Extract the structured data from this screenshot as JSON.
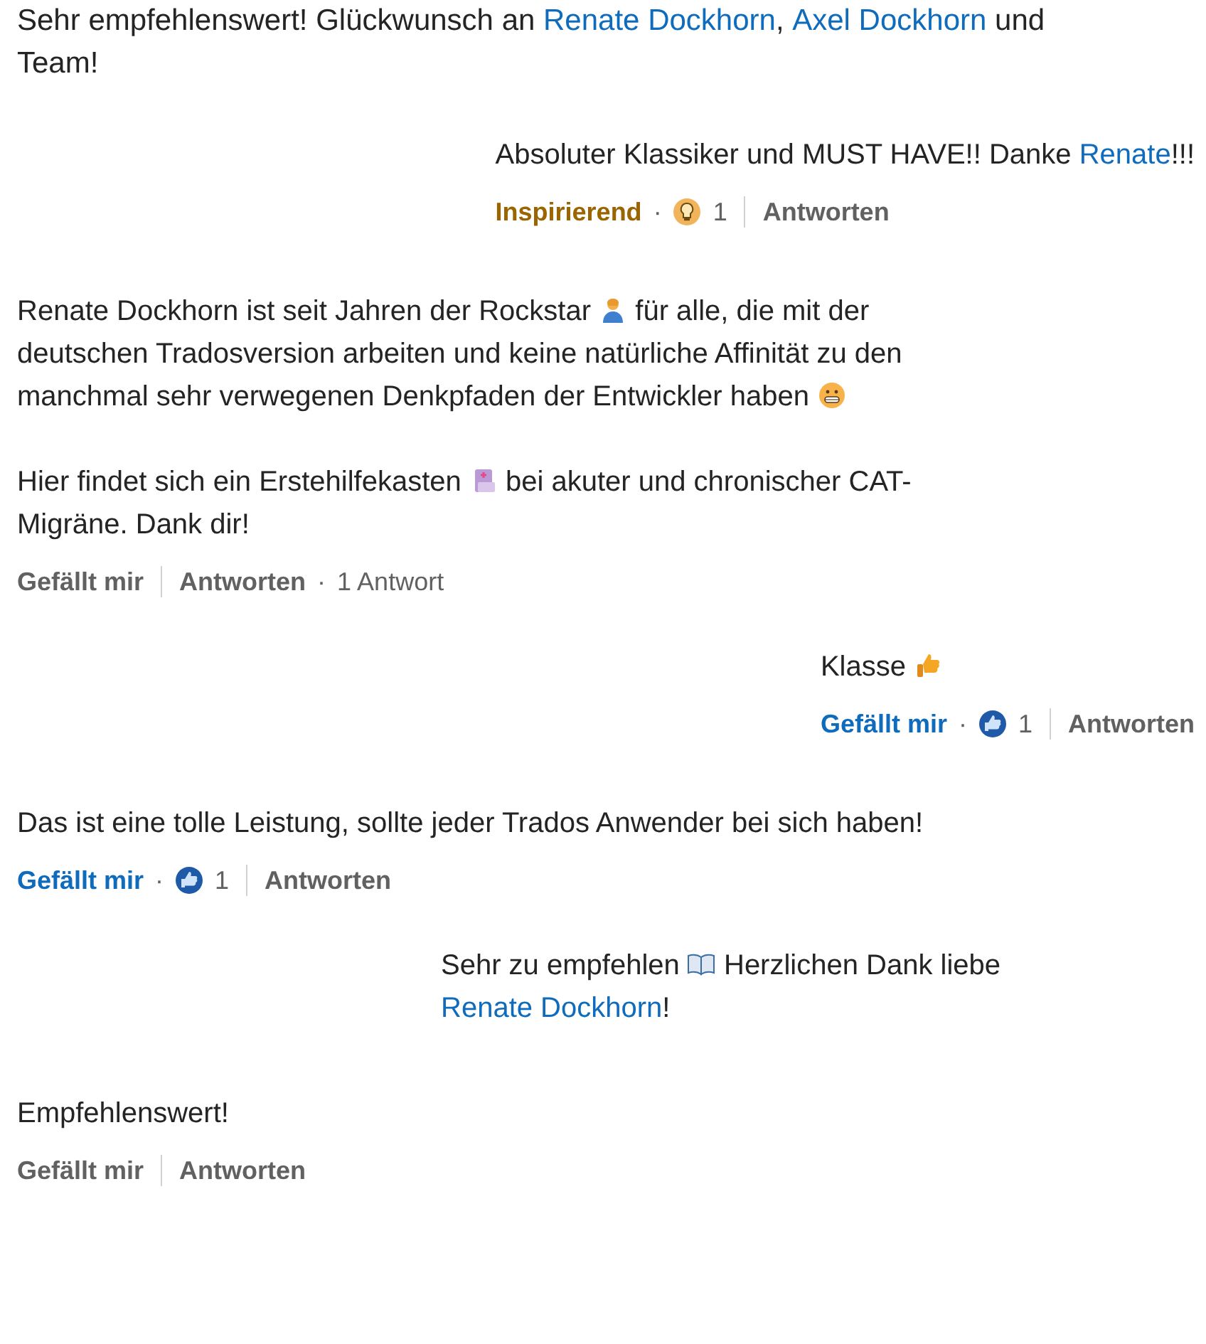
{
  "comments": [
    {
      "paragraphs": [
        [
          {
            "kind": "text",
            "text": "Sehr empfehlenswert! Glückwunsch an "
          },
          {
            "kind": "link",
            "text": "Renate Dockhorn"
          },
          {
            "kind": "text",
            "text": ", "
          },
          {
            "kind": "link",
            "text": "Axel Dockhorn"
          },
          {
            "kind": "text",
            "text": " und Team!"
          }
        ]
      ],
      "children": [
        {
          "paragraphs": [
            [
              {
                "kind": "text",
                "text": "Absoluter Klassiker und MUST HAVE!! Danke "
              },
              {
                "kind": "link",
                "text": "Renate"
              },
              {
                "kind": "text",
                "text": "!!!"
              }
            ]
          ],
          "actions": {
            "reaction": {
              "kind": "inspiring",
              "label": "Inspirierend",
              "selected": true
            },
            "dot": "·",
            "count": "1",
            "reply": "Antworten"
          }
        }
      ]
    },
    {
      "paragraphs": [
        [
          {
            "kind": "text",
            "text": "Renate Dockhorn ist seit Jahren der Rockstar "
          },
          {
            "kind": "icon"
          },
          {
            "kind": "text",
            "text": " für alle, die mit der deutschen Tradosversion arbeiten und keine natürliche Affinität zu den manchmal sehr verwegenen Denkpfaden der Entwickler haben "
          },
          {
            "kind": "icon"
          }
        ],
        [
          {
            "kind": "text",
            "text": "Hier findet sich ein Erstehilfekasten "
          },
          {
            "kind": "icon"
          },
          {
            "kind": "text",
            "text": " bei akuter und chronischer CAT-Migräne. Dank dir!"
          }
        ]
      ],
      "actions": {
        "reaction": {
          "kind": "like",
          "label": "Gefällt mir",
          "selected": false
        },
        "reply": "Antworten",
        "dot": "·",
        "replies": "1 Antwort"
      },
      "children": [
        {
          "paragraphs": [
            [
              {
                "kind": "text",
                "text": "Klasse "
              },
              {
                "kind": "icon"
              }
            ]
          ],
          "actions": {
            "reaction": {
              "kind": "like",
              "label": "Gefällt mir",
              "selected": true
            },
            "dot": "·",
            "count": "1",
            "reply": "Antworten"
          }
        }
      ]
    },
    {
      "paragraphs": [
        [
          {
            "kind": "text",
            "text": "Das ist eine tolle Leistung, sollte jeder Trados Anwender bei sich haben!"
          }
        ]
      ],
      "actions": {
        "reaction": {
          "kind": "like",
          "label": "Gefällt mir",
          "selected": true
        },
        "dot": "·",
        "count": "1",
        "reply": "Antworten"
      },
      "children": [
        {
          "paragraphs": [
            [
              {
                "kind": "text",
                "text": "Sehr zu empfehlen "
              },
              {
                "kind": "icon"
              },
              {
                "kind": "text",
                "text": " Herzlichen Dank liebe "
              },
              {
                "kind": "link",
                "text": "Renate Dockhorn"
              },
              {
                "kind": "text",
                "text": "!"
              }
            ]
          ]
        }
      ]
    },
    {
      "paragraphs": [
        [
          {
            "kind": "text",
            "text": "Empfehlenswert!"
          }
        ]
      ],
      "actions": {
        "reaction": {
          "kind": "like",
          "label": "Gefällt mir",
          "selected": false
        },
        "reply": "Antworten"
      }
    }
  ]
}
